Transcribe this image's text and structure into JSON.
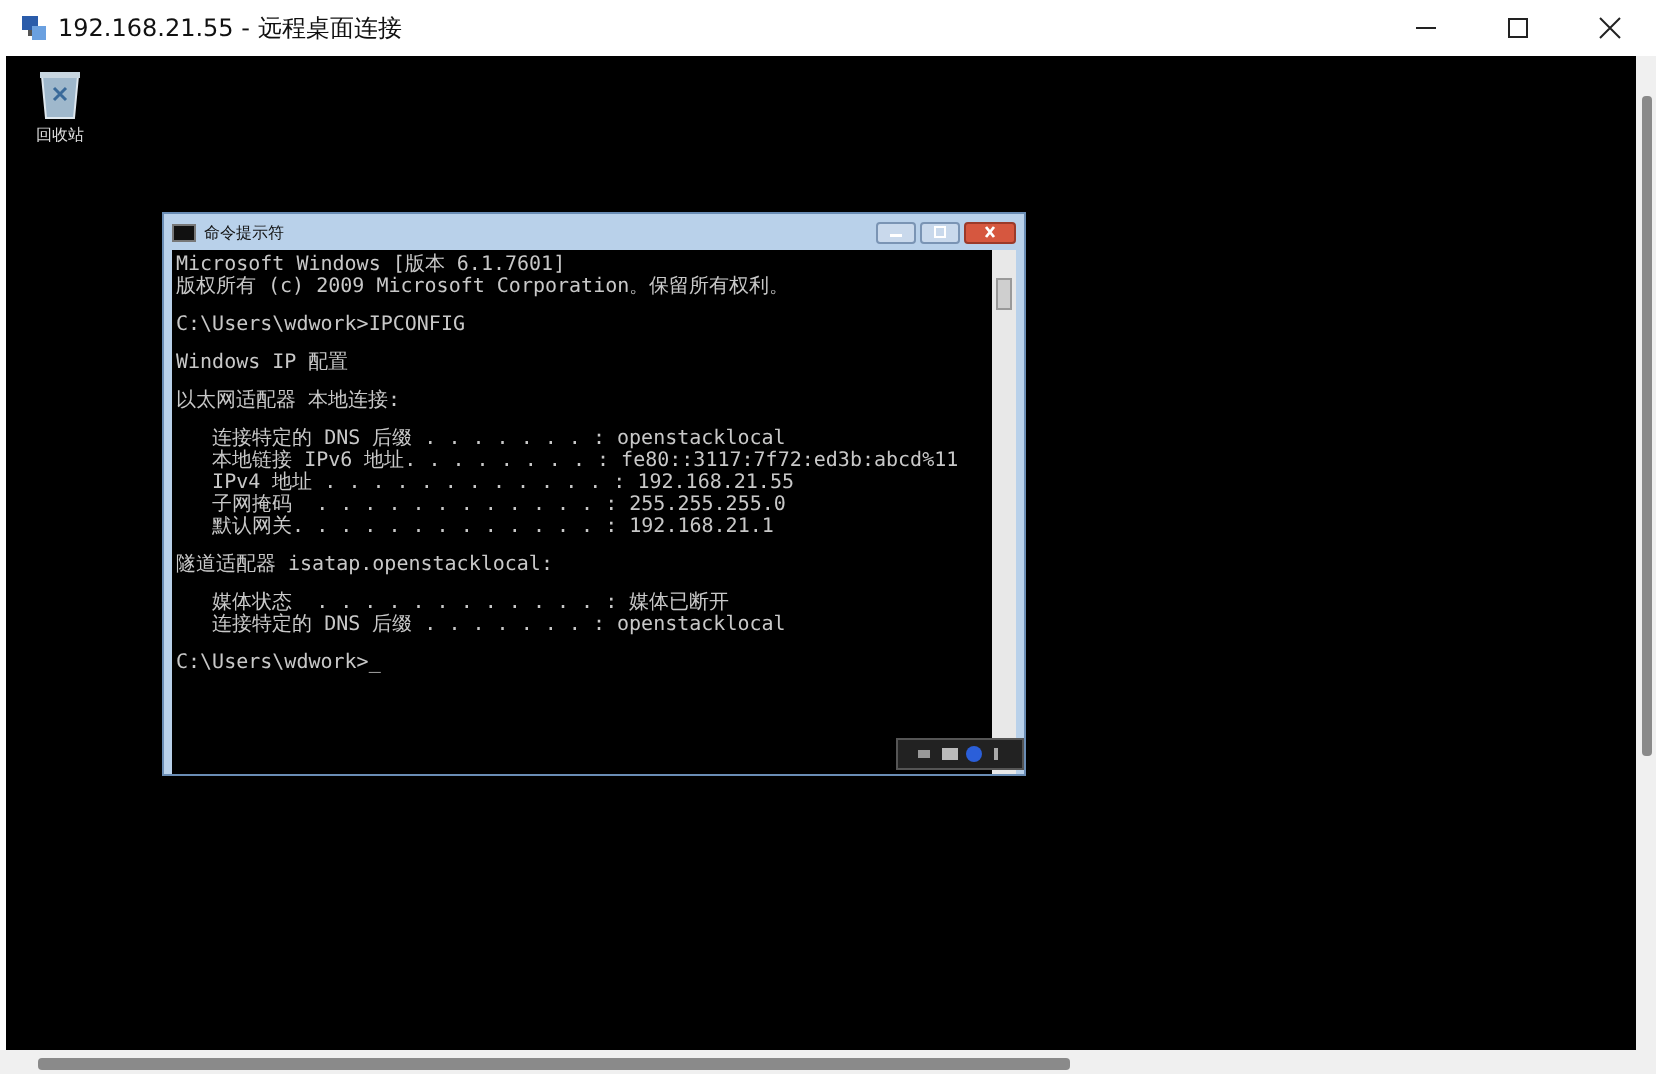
{
  "window": {
    "title": "192.168.21.55 - 远程桌面连接"
  },
  "desktop": {
    "icons": [
      {
        "label": "回收站"
      }
    ]
  },
  "console": {
    "title": "命令提示符",
    "blocks": [
      [
        "Microsoft Windows [版本 6.1.7601]",
        "版权所有 (c) 2009 Microsoft Corporation。保留所有权利。"
      ],
      [
        "C:\\Users\\wdwork>IPCONFIG"
      ],
      [
        "Windows IP 配置"
      ],
      [
        "以太网适配器 本地连接:"
      ],
      [
        "   连接特定的 DNS 后缀 . . . . . . . : openstacklocal",
        "   本地链接 IPv6 地址. . . . . . . . : fe80::3117:7f72:ed3b:abcd%11",
        "   IPv4 地址 . . . . . . . . . . . . : 192.168.21.55",
        "   子网掩码  . . . . . . . . . . . . : 255.255.255.0",
        "   默认网关. . . . . . . . . . . . . : 192.168.21.1"
      ],
      [
        "隧道适配器 isatap.openstacklocal:"
      ],
      [
        "   媒体状态  . . . . . . . . . . . . : 媒体已断开",
        "   连接特定的 DNS 后缀 . . . . . . . : openstacklocal"
      ],
      [
        "C:\\Users\\wdwork>_"
      ]
    ]
  }
}
